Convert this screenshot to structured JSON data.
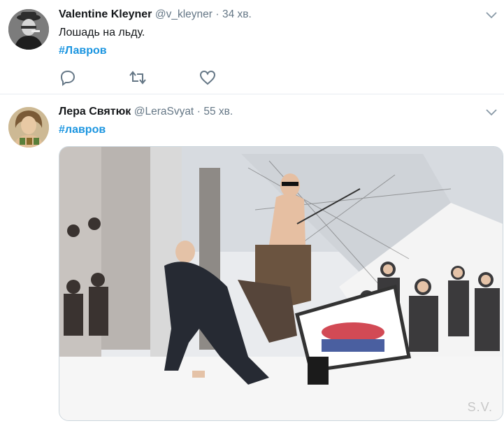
{
  "tweets": [
    {
      "author_name": "Valentine Kleyner",
      "handle": "@v_kleyner",
      "separator": "·",
      "time": "34 хв.",
      "text": "Лошадь на льду.",
      "hashtag": "#Лавров",
      "actions": [
        "reply-icon",
        "retweet-icon",
        "like-icon"
      ]
    },
    {
      "author_name": "Лера Святюк",
      "handle": "@LeraSvyat",
      "separator": "·",
      "time": "55 хв.",
      "hashtag": "#лавров",
      "media_watermark": "S.V."
    }
  ],
  "colors": {
    "link": "#1b95e0",
    "secondary_text": "#657786",
    "divider": "#e6ecf0"
  }
}
